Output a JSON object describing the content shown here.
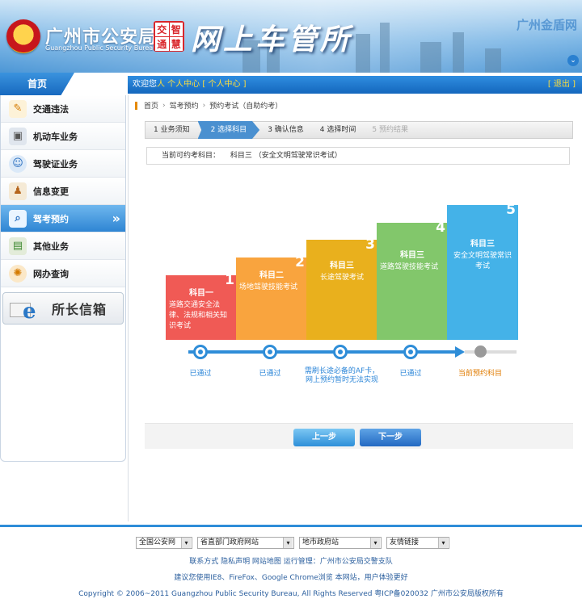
{
  "header": {
    "bureau_name": "广州市公安局",
    "bureau_en": "Guangzhou Public Security Bureau",
    "stamp_chars": [
      "交",
      "智",
      "通",
      "慧"
    ],
    "site_title": "网上车管所",
    "portal_name": "广州金盾网",
    "scroll_icon": "chevron-down-circle-icon"
  },
  "topbar": {
    "home_label": "首页",
    "welcome_prefix": "欢迎您",
    "user_center": "人 个人中心",
    "user_center_link": "[ 个人中心 ]",
    "logout": "[ 退出 ]"
  },
  "sidebar": {
    "items": [
      {
        "label": "交通违法",
        "icon": "pencil-note-icon",
        "active": false
      },
      {
        "label": "机动车业务",
        "icon": "vehicle-screen-icon",
        "active": false
      },
      {
        "label": "驾驶证业务",
        "icon": "driver-avatar-icon",
        "active": false
      },
      {
        "label": "信息变更",
        "icon": "person-change-icon",
        "active": false
      },
      {
        "label": "驾考预约",
        "icon": "magnifier-icon",
        "active": true
      },
      {
        "label": "其他业务",
        "icon": "files-icon",
        "active": false
      },
      {
        "label": "网办查询",
        "icon": "compass-icon",
        "active": false
      }
    ],
    "mailbox_label": "所长信箱"
  },
  "breadcrumb": [
    "首页",
    "驾考预约",
    "预约考试（自助约考）"
  ],
  "steps": [
    {
      "label": "1 业务须知",
      "state": "done"
    },
    {
      "label": "2 选择科目",
      "state": "active"
    },
    {
      "label": "3 确认信息",
      "state": "normal"
    },
    {
      "label": "4 选择时间",
      "state": "normal"
    },
    {
      "label": "5 预约结果",
      "state": "disabled"
    }
  ],
  "subject": {
    "label": "当前可约考科目：",
    "value": "科目三 （安全文明驾驶常识考试）"
  },
  "stairs": [
    {
      "num": "1",
      "title": "科目一",
      "desc": "道路交通安全法律、法规和相关知识考试",
      "color": "#f05a55"
    },
    {
      "num": "2",
      "title": "科目二",
      "desc": "场地驾驶技能考试",
      "color": "#f9a43e"
    },
    {
      "num": "3",
      "title": "科目三",
      "desc": "长途驾驶考试",
      "color": "#e9b01d"
    },
    {
      "num": "4",
      "title": "科目三",
      "desc": "道路驾驶技能考试",
      "color": "#82c76b"
    },
    {
      "num": "5",
      "title": "科目三",
      "desc": "安全文明驾驶常识考试",
      "color": "#44b2e8"
    }
  ],
  "timeline": {
    "status_1": "已通过",
    "status_2": "已通过",
    "status_3": "需刷长途必备的AF卡，网上预约暂时无法实现",
    "status_4": "已通过",
    "status_5": "当前预约科目",
    "current_color": "#e07b00"
  },
  "buttons": {
    "prev": "上一步",
    "next": "下一步"
  },
  "footer": {
    "selects": [
      "全国公安网",
      "省直部门政府网站",
      "地市政府站",
      "友情链接"
    ],
    "links": "联系方式 隐私声明 网站地图 运行管理：广州市公安局交警支队",
    "browser_tip": "建议您使用IE8、FireFox、Google Chrome浏览 本网站，用户体验更好",
    "copyright": "Copyright © 2006~2011 Guangzhou Public Security Bureau, All Rights Reserved 粤ICP备020032 广州市公安局版权所有"
  }
}
